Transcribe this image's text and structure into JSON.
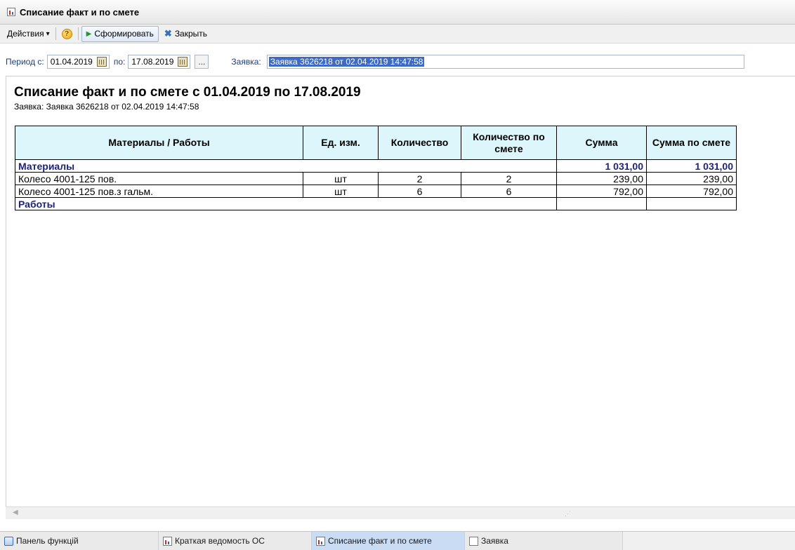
{
  "window": {
    "title": "Списание факт и по смете"
  },
  "toolbar": {
    "actions_label": "Действия",
    "actions_arrow": "▾",
    "help_glyph": "?",
    "form_label": "Сформировать",
    "close_label": "Закрыть"
  },
  "params": {
    "period_from_label": "Период с:",
    "period_from_value": "01.04.2019",
    "period_to_label": "по:",
    "period_to_value": "17.08.2019",
    "dots_label": "...",
    "zayavka_label": "Заявка:",
    "zayavka_value": "Заявка 3626218 от 02.04.2019 14:47:58"
  },
  "report": {
    "title": "Списание факт и по смете с 01.04.2019 по 17.08.2019",
    "subtitle": "Заявка: Заявка 3626218 от 02.04.2019 14:47:58",
    "columns": [
      "Материалы / Работы",
      "Ед. изм.",
      "Количество",
      "Количество по смете",
      "Сумма",
      "Сумма по смете"
    ],
    "groups": {
      "materials": {
        "name": "Материалы",
        "sum": "1 031,00",
        "sum_estimate": "1 031,00"
      },
      "works": {
        "name": "Работы"
      }
    },
    "rows": [
      {
        "name": "Колесо 4001-125 пов.",
        "unit": "шт",
        "qty": "2",
        "qty_estimate": "2",
        "sum": "239,00",
        "sum_estimate": "239,00"
      },
      {
        "name": "Колесо 4001-125 пов.з гальм.",
        "unit": "шт",
        "qty": "6",
        "qty_estimate": "6",
        "sum": "792,00",
        "sum_estimate": "792,00"
      }
    ]
  },
  "taskbar": [
    {
      "label": "Панель функцій",
      "icon": "panel-icon",
      "active": false
    },
    {
      "label": "Краткая ведомость ОС",
      "icon": "report-icon",
      "active": false
    },
    {
      "label": "Списание факт и по смете",
      "icon": "report-icon",
      "active": true
    },
    {
      "label": "Заявка",
      "icon": "document-icon",
      "active": false
    }
  ],
  "colors": {
    "header_bg": "#ddf6fb",
    "group_text": "#1a237e",
    "selection": "#3d6ac4"
  }
}
